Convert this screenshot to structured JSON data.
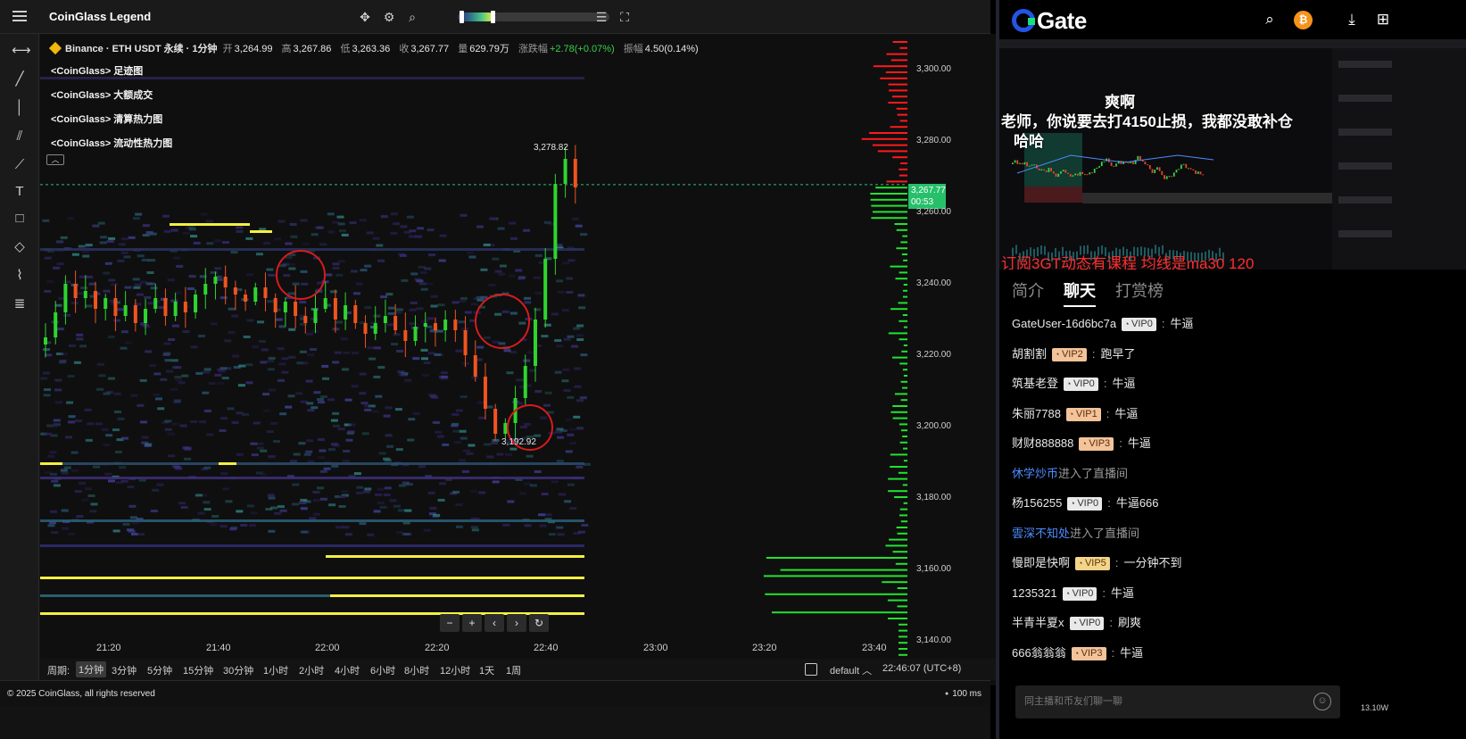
{
  "app": {
    "title": "CoinGlass Legend"
  },
  "symbol_info": {
    "exchange_symbol": "Binance · ETH USDT 永续 · 1分钟",
    "open_label": "开",
    "open": "3,264.99",
    "high_label": "高",
    "high": "3,267.86",
    "low_label": "低",
    "low": "3,263.36",
    "close_label": "收",
    "close": "3,267.77",
    "volume_label": "量",
    "volume": "629.79万",
    "change_label": "涨跌幅",
    "change": "+2.78(+0.07%)",
    "amplitude_label": "振幅",
    "amplitude": "4.50(0.14%)"
  },
  "legend": [
    "<CoinGlass> 足迹图",
    "<CoinGlass> 大额成交",
    "<CoinGlass> 清算热力图",
    "<CoinGlass> 流动性热力图"
  ],
  "chart_data": {
    "type": "candlestick",
    "symbol": "ETH USDT 永续",
    "interval": "1分钟",
    "price_ticks": [
      "3,300.00",
      "3,280.00",
      "3,260.00",
      "3,240.00",
      "3,220.00",
      "3,200.00",
      "3,180.00",
      "3,160.00",
      "3,140.00"
    ],
    "time_ticks": [
      "21:20",
      "21:40",
      "22:00",
      "22:20",
      "22:40",
      "23:00",
      "23:20",
      "23:40"
    ],
    "ylim": [
      3135,
      3310
    ],
    "current_price": "3,267.77",
    "countdown": "00:53",
    "marked_high": "3,278.82",
    "marked_low": "3,192.92",
    "close_path": [
      3225,
      3232,
      3240,
      3236,
      3238,
      3233,
      3236,
      3231,
      3234,
      3229,
      3233,
      3236,
      3231,
      3235,
      3232,
      3237,
      3240,
      3242,
      3239,
      3237,
      3235,
      3239,
      3236,
      3232,
      3235,
      3231,
      3229,
      3233,
      3236,
      3230,
      3234,
      3229,
      3226,
      3229,
      3231,
      3227,
      3224,
      3228,
      3229,
      3227,
      3230,
      3227,
      3220,
      3214,
      3205,
      3198,
      3201,
      3208,
      3217,
      3230,
      3247,
      3268,
      3275,
      3267
    ]
  },
  "nav_buttons": [
    "−",
    "+",
    "‹",
    "›",
    "↻"
  ],
  "period_bar": {
    "label": "周期:",
    "items": [
      "1分钟",
      "3分钟",
      "5分钟",
      "15分钟",
      "30分钟",
      "1小时",
      "2小时",
      "4小时",
      "6小时",
      "8小时",
      "12小时",
      "1天",
      "1周"
    ],
    "active": "1分钟",
    "theme": "default",
    "clock": "22:46:07 (UTC+8)"
  },
  "footer": {
    "copyright": "© 2025 CoinGlass, all rights reserved",
    "latency": "100 ms"
  },
  "gate": {
    "logo": "Gate",
    "overlay": {
      "line1": "爽啊",
      "line2": "老师，你说要去打4150止损，我都没敢补仓",
      "line3": "哈哈",
      "red_line": "订阅3GT动态有课程 均线是ma30 120"
    },
    "tabs": [
      "简介",
      "聊天",
      "打赏榜"
    ],
    "active_tab": "聊天",
    "messages": [
      {
        "user": "GateUser-16d6bc7a",
        "vip": "VIP0",
        "text": "牛逼"
      },
      {
        "user": "胡割割",
        "vip": "VIP2",
        "text": "跑早了"
      },
      {
        "user": "筑基老登",
        "vip": "VIP0",
        "text": "牛逼"
      },
      {
        "user": "朱丽7788",
        "vip": "VIP1",
        "text": "牛逼"
      },
      {
        "user": "财财888888",
        "vip": "VIP3",
        "text": "牛逼"
      },
      {
        "system_user": "休学炒币",
        "system_text": "进入了直播间"
      },
      {
        "user": "杨156255",
        "vip": "VIP0",
        "text": "牛逼666"
      },
      {
        "system_user": "雲深不知处",
        "system_text": "进入了直播间"
      },
      {
        "user": "慢即是快啊",
        "vip": "VIP5",
        "text": "一分钟不到"
      },
      {
        "user": "1235321",
        "vip": "VIP0",
        "text": "牛逼"
      },
      {
        "user": "半青半夏x",
        "vip": "VIP0",
        "text": "刷爽"
      },
      {
        "user": "666翁翁翁",
        "vip": "VIP3",
        "text": "牛逼"
      }
    ],
    "chat_placeholder": "同主播和币友们聊一聊",
    "online_count": "13.10W"
  },
  "colors": {
    "up": "#2ed52e",
    "down": "#f0541e",
    "bid_book": "#22e32e",
    "ask_book": "#ff1a1a",
    "big_order": "#f4f040"
  }
}
